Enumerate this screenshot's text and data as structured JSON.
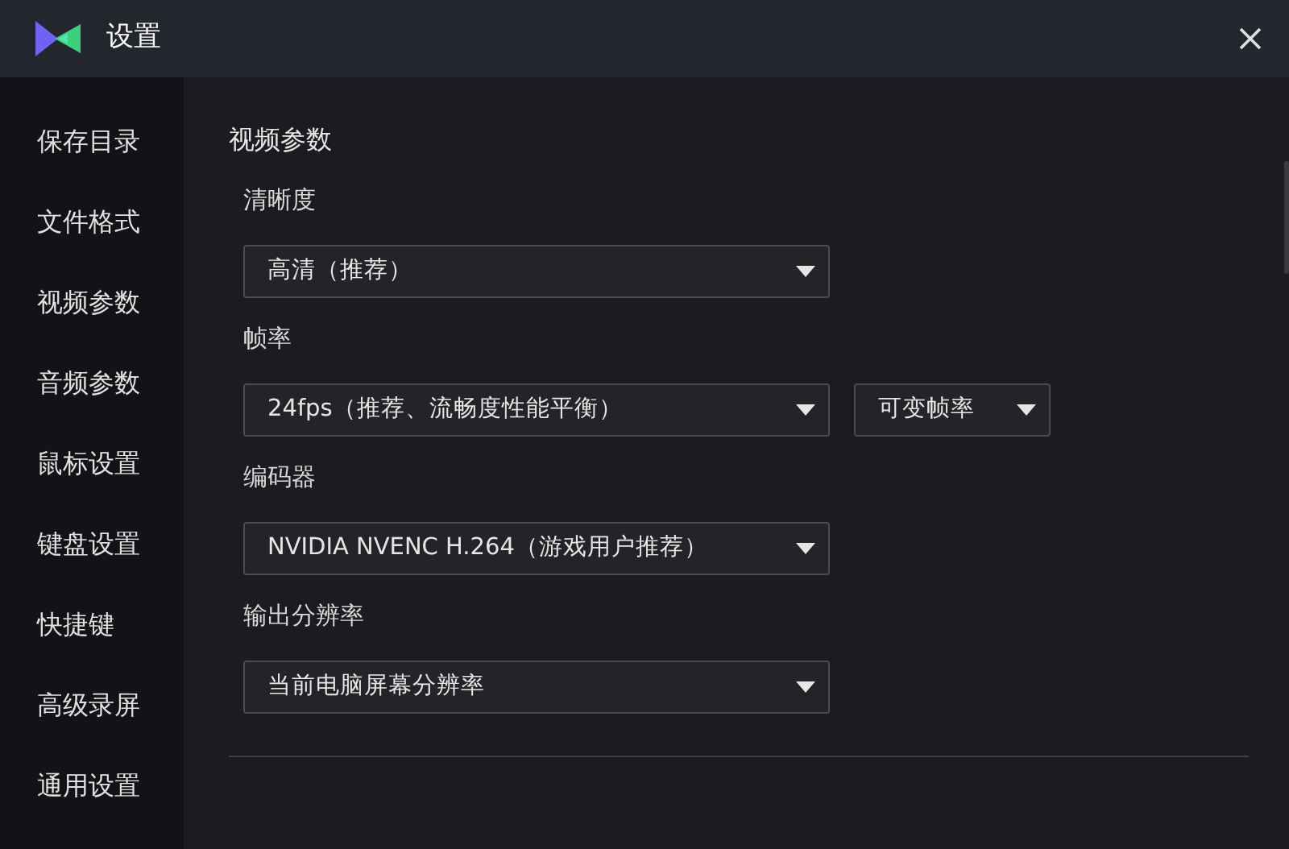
{
  "window": {
    "title": "设置"
  },
  "sidebar": {
    "items": [
      {
        "label": "保存目录"
      },
      {
        "label": "文件格式"
      },
      {
        "label": "视频参数"
      },
      {
        "label": "音频参数"
      },
      {
        "label": "鼠标设置"
      },
      {
        "label": "键盘设置"
      },
      {
        "label": "快捷键"
      },
      {
        "label": "高级录屏"
      },
      {
        "label": "通用设置"
      }
    ]
  },
  "section": {
    "title": "视频参数",
    "fields": [
      {
        "label": "清晰度",
        "dropdowns": [
          {
            "value": "高清（推荐）",
            "kind": "wide"
          }
        ]
      },
      {
        "label": "帧率",
        "dropdowns": [
          {
            "value": "24fps（推荐、流畅度性能平衡）",
            "kind": "wide"
          },
          {
            "value": "可变帧率",
            "kind": "narrow"
          }
        ]
      },
      {
        "label": "编码器",
        "dropdowns": [
          {
            "value": "NVIDIA NVENC H.264（游戏用户推荐）",
            "kind": "wide"
          }
        ]
      },
      {
        "label": "输出分辨率",
        "dropdowns": [
          {
            "value": "当前电脑屏幕分辨率",
            "kind": "wide"
          }
        ]
      }
    ]
  }
}
